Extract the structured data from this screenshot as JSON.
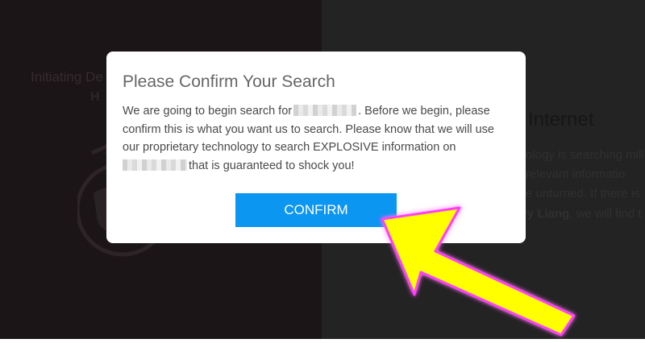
{
  "background": {
    "left_status": "Initiating De",
    "left_sub": "H",
    "right_heading": "Internet",
    "right_lines": [
      {
        "text": "ology is searching mill"
      },
      {
        "text": "relevant informatio"
      },
      {
        "text": "e unturned. If there is"
      },
      {
        "bold": "ry Liang",
        "text": ", we will find t"
      }
    ]
  },
  "modal": {
    "title": "Please Confirm Your Search",
    "body_part1": "We are going to begin search for",
    "body_part2": ". Before we begin, please confirm this is what you want us to search. Please know that we will use our proprietary technology to search EXPLOSIVE information on",
    "body_part3": "that is guaranteed to shock you!",
    "confirm_label": "CONFIRM"
  },
  "colors": {
    "button": "#0b96f1",
    "arrow_fill": "#ffff00",
    "arrow_glow": "#ff3cff",
    "left_panel": "#1c1517",
    "right_panel": "#232323"
  },
  "icons": [
    "globe-icon",
    "pointer-arrow-icon"
  ]
}
